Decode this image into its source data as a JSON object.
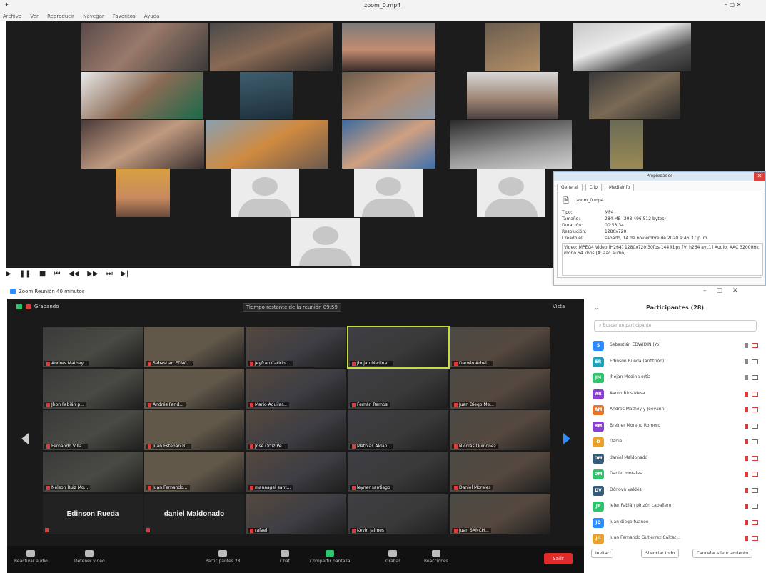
{
  "player": {
    "title": "zoom_0.mp4",
    "menu": [
      "Archivo",
      "Ver",
      "Reproducir",
      "Navegar",
      "Favoritos",
      "Ayuda"
    ],
    "window_controls": "–  ▢  ✕",
    "controls": [
      "▶",
      "❚❚",
      "■",
      "⏮",
      "◀◀",
      "▶▶",
      "⏭",
      "▶|"
    ]
  },
  "properties": {
    "title": "Propiedades",
    "tabs": [
      "General",
      "Clip",
      "MediaInfo"
    ],
    "filename": "zoom_0.mp4",
    "rows": [
      {
        "key": "Tipo:",
        "value": "MP4"
      },
      {
        "key": "Tamaño:",
        "value": "284 MB (298.496.512 bytes)"
      },
      {
        "key": "Duración:",
        "value": "00:58:34"
      },
      {
        "key": "Resolución:",
        "value": "1280x720"
      },
      {
        "key": "Creado el:",
        "value": "sábado, 14 de noviembre de 2020 9:46:37 p. m."
      }
    ],
    "info": "Video: MPEG4 Video (H264) 1280x720 30fps 144 kbps [V: h264 avc1] Audio: AAC 32000Hz mono 64 kbps [A: aac audio]"
  },
  "zoom": {
    "title": "Zoom Reunión 40 minutos",
    "recording": "Grabando",
    "timer": "Tiempo restante de la reunión 09:59",
    "view": "Vista",
    "tiles": [
      "Andres Mathey...",
      "Sebastian EDWI...",
      "Jeyfran Catiriol...",
      "Jhojan Medina...",
      "Darwin Arbel...",
      "Jhon Fabián p...",
      "Andrés Farid...",
      "Mario Aguilar...",
      "Fernán Ramos",
      "Juan Diego Me...",
      "Fernando Villa...",
      "Juan Esteban B...",
      "José Ortiz Pe...",
      "Mathias Aldan...",
      "Nicolás Quiñonez",
      "Nelson Ruiz Mo...",
      "Juan Fernando...",
      "manaagel sant...",
      "leyner santiago",
      "Daniel Morales",
      "",
      "",
      "rafael",
      "Kevin Jaimes",
      "Juan SANCH..."
    ],
    "name_tiles": {
      "edinson": "Edinson Rueda",
      "daniel": "daniel Maldonado"
    },
    "toolbar": {
      "audio": "Reactivar audio",
      "video": "Detener video",
      "participants": "Participantes",
      "participants_count": "28",
      "chat": "Chat",
      "share": "Compartir pantalla",
      "record": "Grabar",
      "reactions": "Reacciones",
      "leave": "Salir"
    },
    "panel": {
      "title": "Participantes (28)",
      "search_placeholder": "Buscar un participante",
      "participants": [
        {
          "initials": "S",
          "name": "Sebastián EDWIDIN (Yo)",
          "color": "#2d8cff"
        },
        {
          "initials": "ER",
          "name": "Edinson Rueda (anfitrión)",
          "color": "#20a0b8"
        },
        {
          "initials": "JM",
          "name": "Jhojan Medina ortiz",
          "color": "#2ec46e"
        },
        {
          "initials": "AR",
          "name": "Aaron Ríos Mesa",
          "color": "#8a3fd1"
        },
        {
          "initials": "AM",
          "name": "Andres Mathey y Jeovanni",
          "color": "#e8742b"
        },
        {
          "initials": "BM",
          "name": "Breiner Moreno Romero",
          "color": "#8a3fd1"
        },
        {
          "initials": "D",
          "name": "Daniel",
          "color": "#e8a22b"
        },
        {
          "initials": "DM",
          "name": "daniel Maldonado",
          "color": "#335b7a"
        },
        {
          "initials": "DM",
          "name": "Daniel morales",
          "color": "#2ec46e"
        },
        {
          "initials": "DV",
          "name": "Dónovn Valdés",
          "color": "#335b7a"
        },
        {
          "initials": "JP",
          "name": "Jefer Fabián pinzón caballero",
          "color": "#2ec46e"
        },
        {
          "initials": "JD",
          "name": "Juan diego tuaneo",
          "color": "#2d8cff"
        },
        {
          "initials": "JG",
          "name": "Juan Fernando Gutiérrez Calcat...",
          "color": "#e8a22b"
        }
      ],
      "footer": {
        "invite": "Invitar",
        "mute_all": "Silenciar todo",
        "unmute_all": "Cancelar silenciamiento"
      }
    }
  },
  "colors": {
    "accent": "#2d8cff",
    "danger": "#e02b2b",
    "ok": "#2ec46e"
  }
}
